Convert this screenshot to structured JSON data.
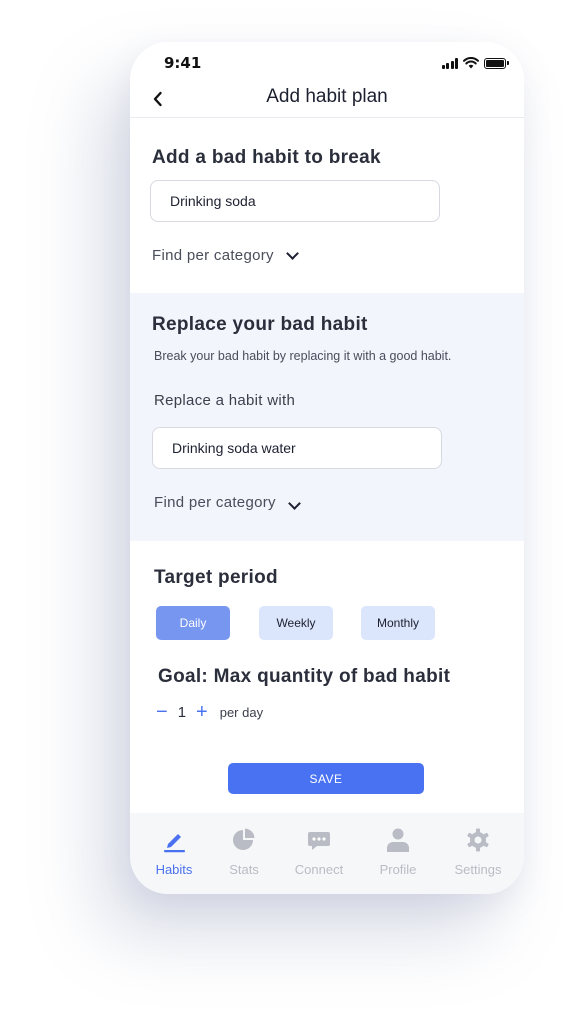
{
  "status_bar": {
    "time": "9:41"
  },
  "nav": {
    "title": "Add habit plan"
  },
  "bad_habit": {
    "title": "Add a bad habit to break",
    "input_value": "Drinking soda",
    "category_label": "Find per category"
  },
  "replace": {
    "title": "Replace your bad habit",
    "hint": "Break your bad habit by replacing it with a good habit.",
    "field_label": "Replace a habit with",
    "input_value": "Drinking soda water",
    "category_label": "Find per category"
  },
  "target": {
    "title": "Target period",
    "options": [
      {
        "label": "Daily",
        "selected": true
      },
      {
        "label": "Weekly",
        "selected": false
      },
      {
        "label": "Monthly",
        "selected": false
      }
    ]
  },
  "goal": {
    "title": "Goal: Max quantity of bad habit",
    "minus": "−",
    "plus": "+",
    "quantity": "1",
    "unit": "per day"
  },
  "save_label": "SAVE",
  "tabs": [
    {
      "label": "Habits",
      "icon": "pencil-icon",
      "active": true
    },
    {
      "label": "Stats",
      "icon": "pie-chart-icon",
      "active": false
    },
    {
      "label": "Connect",
      "icon": "chat-bubble-icon",
      "active": false
    },
    {
      "label": "Profile",
      "icon": "person-icon",
      "active": false
    },
    {
      "label": "Settings",
      "icon": "gear-icon",
      "active": false
    }
  ],
  "colors": {
    "accent": "#4872f2",
    "selected_chip": "#7796f0",
    "unselected_chip": "#dbe5fb",
    "section_bg": "#f2f5fc",
    "inactive_tab": "#b9bcc4"
  }
}
